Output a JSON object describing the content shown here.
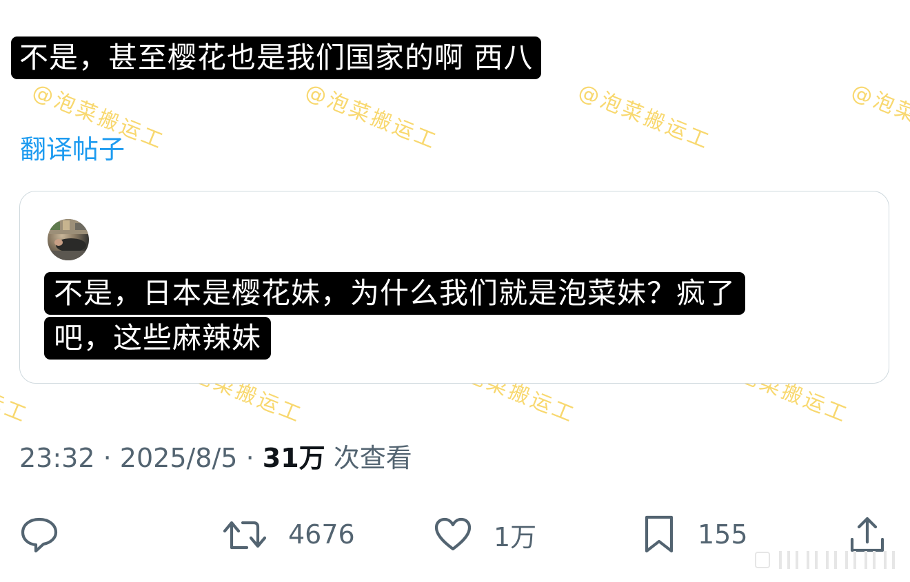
{
  "post": {
    "caption": "不是，甚至樱花也是我们国家的啊 西八",
    "translate_label": "翻译帖子"
  },
  "quote": {
    "caption_line_1": "不是，日本是樱花妹，为什么我们就是泡菜妹？疯了",
    "caption_line_2": "吧，这些麻辣妹"
  },
  "meta": {
    "time": "23:32",
    "date": "2025/8/5",
    "separator": "·",
    "views_count": "31万",
    "views_label": "次查看"
  },
  "actions": {
    "reply": {
      "icon": "reply-icon"
    },
    "retweet": {
      "icon": "retweet-icon",
      "count": "4676"
    },
    "like": {
      "icon": "heart-icon",
      "count": "1万"
    },
    "bookmark": {
      "icon": "bookmark-icon",
      "count": "155"
    },
    "share": {
      "icon": "share-icon"
    }
  },
  "watermark": {
    "text": "@泡菜搬运工"
  },
  "colors": {
    "link": "#1d9bf0",
    "muted": "#536471",
    "text": "#0f1419",
    "caption_bg": "#000000",
    "caption_fg": "#ffffff",
    "watermark": "#f6cd46",
    "card_border": "#cfd9de"
  }
}
